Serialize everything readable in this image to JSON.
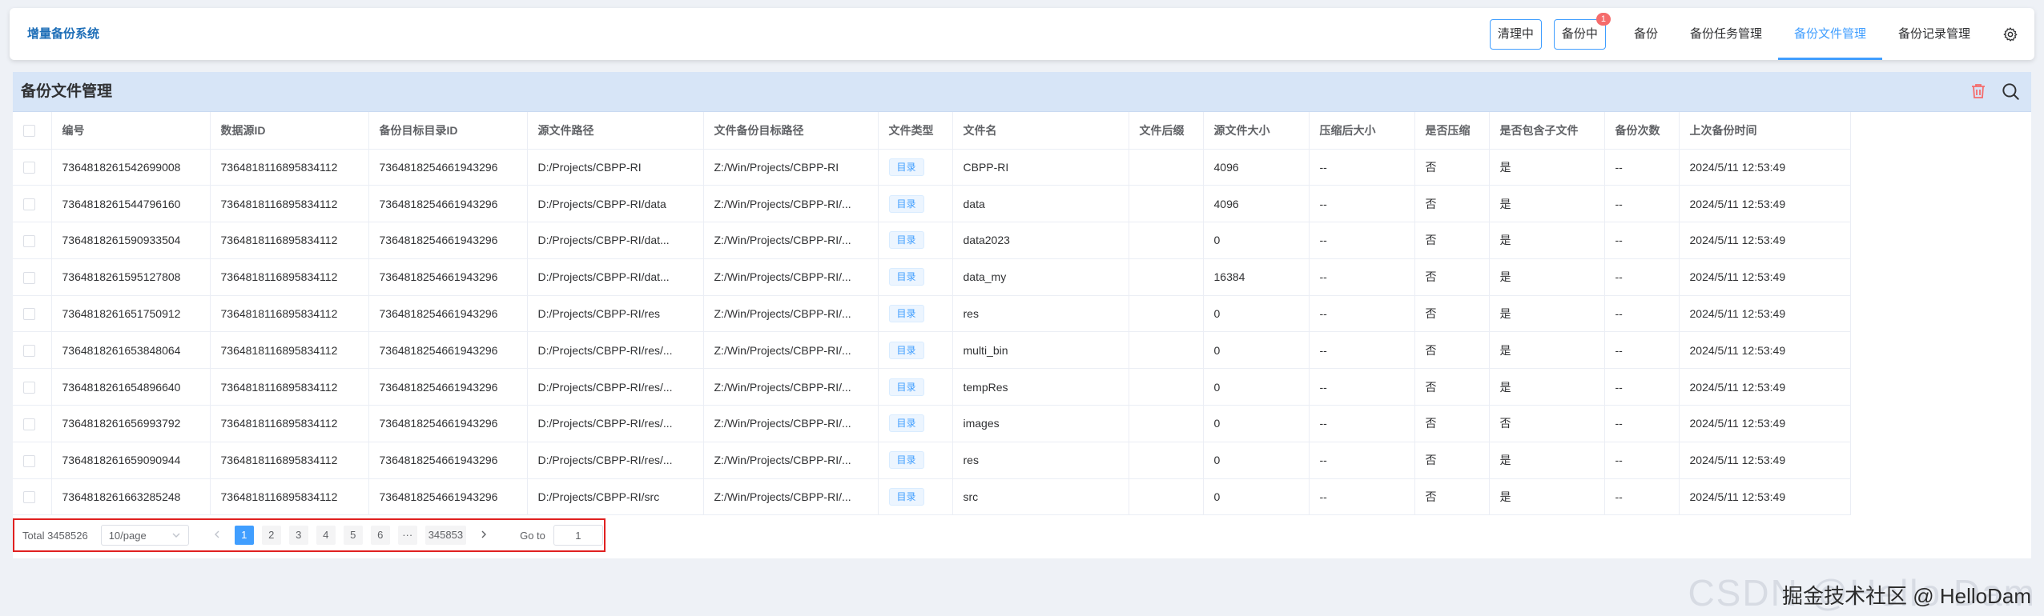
{
  "app": {
    "title": "增量备份系统"
  },
  "nav": {
    "status_cleaning": "清理中",
    "status_backing": "备份中",
    "backing_badge": "1",
    "items": [
      "备份",
      "备份任务管理",
      "备份文件管理",
      "备份记录管理"
    ],
    "active": "备份文件管理"
  },
  "panel": {
    "title": "备份文件管理"
  },
  "table": {
    "columns": [
      "编号",
      "数据源ID",
      "备份目标目录ID",
      "源文件路径",
      "文件备份目标路径",
      "文件类型",
      "文件名",
      "文件后缀",
      "源文件大小",
      "压缩后大小",
      "是否压缩",
      "是否包含子文件",
      "备份次数",
      "上次备份时间"
    ],
    "rows": [
      [
        "7364818261542699008",
        "7364818116895834112",
        "7364818254661943296",
        "D:/Projects/CBPP-RI",
        "Z:/Win/Projects/CBPP-RI",
        "目录",
        "CBPP-RI",
        "",
        "4096",
        "--",
        "否",
        "是",
        "--",
        "2024/5/11 12:53:49"
      ],
      [
        "7364818261544796160",
        "7364818116895834112",
        "7364818254661943296",
        "D:/Projects/CBPP-RI/data",
        "Z:/Win/Projects/CBPP-RI/...",
        "目录",
        "data",
        "",
        "4096",
        "--",
        "否",
        "是",
        "--",
        "2024/5/11 12:53:49"
      ],
      [
        "7364818261590933504",
        "7364818116895834112",
        "7364818254661943296",
        "D:/Projects/CBPP-RI/dat...",
        "Z:/Win/Projects/CBPP-RI/...",
        "目录",
        "data2023",
        "",
        "0",
        "--",
        "否",
        "是",
        "--",
        "2024/5/11 12:53:49"
      ],
      [
        "7364818261595127808",
        "7364818116895834112",
        "7364818254661943296",
        "D:/Projects/CBPP-RI/dat...",
        "Z:/Win/Projects/CBPP-RI/...",
        "目录",
        "data_my",
        "",
        "16384",
        "--",
        "否",
        "是",
        "--",
        "2024/5/11 12:53:49"
      ],
      [
        "7364818261651750912",
        "7364818116895834112",
        "7364818254661943296",
        "D:/Projects/CBPP-RI/res",
        "Z:/Win/Projects/CBPP-RI/...",
        "目录",
        "res",
        "",
        "0",
        "--",
        "否",
        "是",
        "--",
        "2024/5/11 12:53:49"
      ],
      [
        "7364818261653848064",
        "7364818116895834112",
        "7364818254661943296",
        "D:/Projects/CBPP-RI/res/...",
        "Z:/Win/Projects/CBPP-RI/...",
        "目录",
        "multi_bin",
        "",
        "0",
        "--",
        "否",
        "是",
        "--",
        "2024/5/11 12:53:49"
      ],
      [
        "7364818261654896640",
        "7364818116895834112",
        "7364818254661943296",
        "D:/Projects/CBPP-RI/res/...",
        "Z:/Win/Projects/CBPP-RI/...",
        "目录",
        "tempRes",
        "",
        "0",
        "--",
        "否",
        "是",
        "--",
        "2024/5/11 12:53:49"
      ],
      [
        "7364818261656993792",
        "7364818116895834112",
        "7364818254661943296",
        "D:/Projects/CBPP-RI/res/...",
        "Z:/Win/Projects/CBPP-RI/...",
        "目录",
        "images",
        "",
        "0",
        "--",
        "否",
        "否",
        "--",
        "2024/5/11 12:53:49"
      ],
      [
        "7364818261659090944",
        "7364818116895834112",
        "7364818254661943296",
        "D:/Projects/CBPP-RI/res/...",
        "Z:/Win/Projects/CBPP-RI/...",
        "目录",
        "res",
        "",
        "0",
        "--",
        "否",
        "是",
        "--",
        "2024/5/11 12:53:49"
      ],
      [
        "7364818261663285248",
        "7364818116895834112",
        "7364818254661943296",
        "D:/Projects/CBPP-RI/src",
        "Z:/Win/Projects/CBPP-RI/...",
        "目录",
        "src",
        "",
        "0",
        "--",
        "否",
        "是",
        "--",
        "2024/5/11 12:53:49"
      ]
    ]
  },
  "pagination": {
    "total": "Total 3458526",
    "page_size": "10/page",
    "pages": [
      "1",
      "2",
      "3",
      "4",
      "5",
      "6",
      "···",
      "345853"
    ],
    "current": "1",
    "goto_label": "Go to",
    "goto_value": "1"
  },
  "watermark": {
    "text": "CSDN @Hello Dam",
    "overlay": "掘金技术社区 @ HelloDam"
  },
  "colors": {
    "primary": "#409eff",
    "danger": "#f56c6c",
    "header_bg": "#d7e5f7"
  }
}
